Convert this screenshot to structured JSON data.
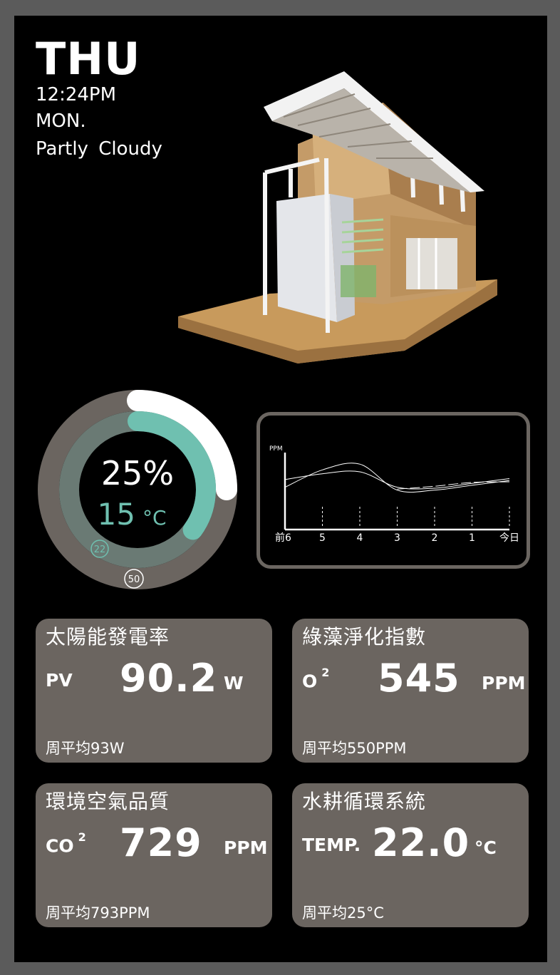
{
  "header": {
    "day": "THU",
    "time": "12:24PM",
    "weekday": "MON.",
    "weather": "Partly Cloudy"
  },
  "gauge": {
    "humidity": "25%",
    "temperature_value": "15",
    "temperature_unit": "°C",
    "inner_marker": "22",
    "outer_marker": "50",
    "humidity_fraction": 0.25,
    "temperature_fraction": 0.35,
    "colors": {
      "outer_track": "#6b6560",
      "inner_track": "#6a7a74",
      "humidity_arc": "#ffffff",
      "temp_arc": "#6fc0b0"
    }
  },
  "chart_data": {
    "type": "line",
    "ylabel": "PPM",
    "categories": [
      "前6",
      "5",
      "4",
      "3",
      "2",
      "1",
      "今日"
    ],
    "series": [
      {
        "values": [
          560,
          590,
          600,
          520,
          515,
          540,
          565
        ]
      },
      {
        "values": [
          520,
          610,
          640,
          505,
          505,
          530,
          555
        ]
      },
      {
        "values": [
          null,
          null,
          null,
          510,
          525,
          545,
          548
        ]
      }
    ],
    "ylim": [
      300,
      700
    ],
    "grid": false
  },
  "cards": [
    {
      "title": "太陽能發電率",
      "label": "PV",
      "label_sup": "",
      "value": "90.2",
      "unit": "W",
      "average": "周平均93W"
    },
    {
      "title": "綠藻淨化指數",
      "label": "O",
      "label_sup": "2",
      "value": "545",
      "unit": "PPM",
      "average": "周平均550PPM"
    },
    {
      "title": "環境空氣品質",
      "label": "CO",
      "label_sup": "2",
      "value": "729",
      "unit": "PPM",
      "average": "周平均793PPM"
    },
    {
      "title": "水耕循環系統",
      "label": "TEMP.",
      "label_sup": "",
      "value": "22.0",
      "unit": "°C",
      "average": "周平均25°C"
    }
  ]
}
